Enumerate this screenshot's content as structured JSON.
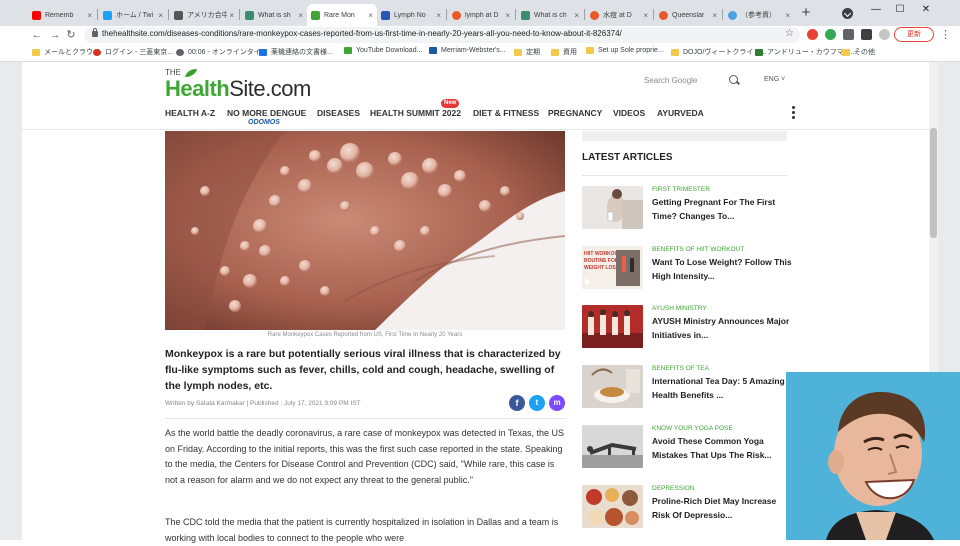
{
  "browser": {
    "tabs": [
      {
        "title": "Rememb",
        "color": "#ff0000"
      },
      {
        "title": "ホーム / Twi",
        "color": "#1da1f2"
      },
      {
        "title": "アメリカ合中",
        "color": "#555555"
      },
      {
        "title": "What is sh",
        "color": "#3c8d6e"
      },
      {
        "title": "Rare Mon",
        "color": "#3fa535"
      },
      {
        "title": "Lymph No",
        "color": "#2a57b5"
      },
      {
        "title": "lymph at D",
        "color": "#e8592b"
      },
      {
        "title": "What is ch",
        "color": "#3c8d6e"
      },
      {
        "title": "水痘 at D",
        "color": "#e8592b"
      },
      {
        "title": "Queenslar",
        "color": "#e8592b"
      },
      {
        "title": "（参考資）",
        "color": "#4aa3df"
      }
    ],
    "active_tab_index": 4,
    "url": "thehealthsite.com/diseases-conditions/rare-monkeypox-cases-reported-from-us-first-time-in-nearly-20-years-all-you-need-to-know-about-it-826374/",
    "update_label": "更新",
    "bookmarks": [
      {
        "label": "メールとクラウド",
        "color": "#f2c94c"
      },
      {
        "label": "ログイン - 三菱東京...",
        "color": "#d93025"
      },
      {
        "label": "00:06 - オンラインタイ...",
        "color": "#5f6368"
      },
      {
        "label": "薬機連絡の文書様...",
        "color": "#1a73e8"
      },
      {
        "label": "YouTube Download...",
        "color": "#3fa535"
      },
      {
        "label": "Merriam-Webster's...",
        "color": "#1a5aa3"
      },
      {
        "label": "定期",
        "color": "#f2c94c"
      },
      {
        "label": "資用",
        "color": "#f2c94c"
      },
      {
        "label": "Set up Sole proprie...",
        "color": "#f2c94c"
      },
      {
        "label": "DOJO/ヴィートクライト...",
        "color": "#f2c94c"
      },
      {
        "label": "アンドリュー・カウフマン...",
        "color": "#2e7d32"
      },
      {
        "label": "その他",
        "color": "#f2c94c"
      }
    ]
  },
  "site": {
    "logo_the": "THE",
    "logo_health": "Health",
    "logo_site": "Site.com",
    "search_placeholder": "Search Google",
    "lang": "ENG ˅",
    "nav": [
      "HEALTH A-Z",
      "NO MORE DENGUE",
      "DISEASES",
      "HEALTH SUMMIT 2022",
      "DIET & FITNESS",
      "PREGNANCY",
      "VIDEOS",
      "AYURVEDA"
    ],
    "nav_sub": "ODOMOS",
    "new_badge": "New"
  },
  "article": {
    "caption": "Rare Monkeypox Cases Reported from US, First Time In Nearly 20 Years",
    "lead": "Monkeypox is a rare but potentially serious viral illness that is characterized by flu-like symptoms such as fever, chills, cold and cough, headache, swelling of the lymph nodes, etc.",
    "byline": "Written by Satata Karmakar | Published : July 17, 2021 9:09 PM IST",
    "p1": "As the world battle the deadly coronavirus, a rare case of monkeypox was detected in Texas, the US on Friday. According to the initial reports, this was the first such case reported in the state. Speaking to the media, the Centers for Disease Control and Prevention (CDC) said, \"While rare, this case is not a reason for alarm and we do not expect any threat to the general public.\"",
    "p2": "The CDC told the media that the patient is currently hospitalized in isolation in Dallas and a team is working with local bodies to connect to the people who were"
  },
  "sidebar": {
    "title": "LATEST ARTICLES",
    "articles": [
      {
        "category": "FIRST TRIMESTER",
        "title": "Getting Pregnant For The First Time? Changes To..."
      },
      {
        "category": "BENEFITS OF HIIT WORKOUT",
        "title": "Want To Lose Weight? Follow This High Intensity..."
      },
      {
        "category": "AYUSH MINISTRY",
        "title": "AYUSH Ministry Announces Major Initiatives in..."
      },
      {
        "category": "BENEFITS OF TEA",
        "title": "International Tea Day: 5 Amazing Health Benefits ..."
      },
      {
        "category": "KNOW YOUR YOGA POSE",
        "title": "Avoid These Common Yoga Mistakes That Ups The Risk..."
      },
      {
        "category": "DEPRESSION",
        "title": "Proline-Rich Diet May Increase Risk Of Depressio..."
      }
    ],
    "thumb_hiit_text": "HIIT WORKOUT ROUTINE FOR WEIGHT LOSS"
  },
  "colors": {
    "brand_green": "#3fa535",
    "facebook": "#3b5998",
    "twitter": "#1da1f2",
    "messenger": "#7b4bff"
  }
}
